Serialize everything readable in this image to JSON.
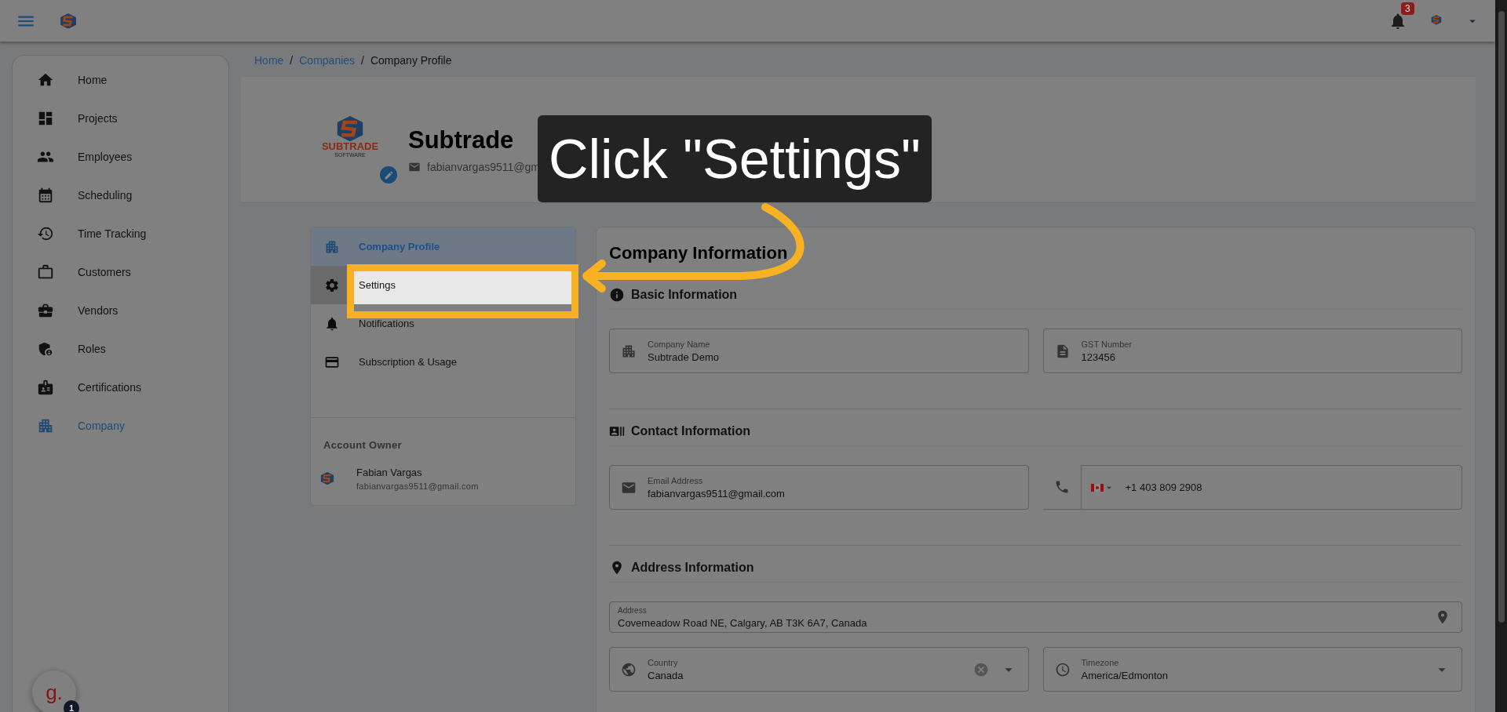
{
  "top_bar": {
    "notification_count": "3"
  },
  "sidebar": {
    "items": [
      {
        "label": "Home",
        "selected": false
      },
      {
        "label": "Projects",
        "selected": false
      },
      {
        "label": "Employees",
        "selected": false
      },
      {
        "label": "Scheduling",
        "selected": false
      },
      {
        "label": "Time Tracking",
        "selected": false
      },
      {
        "label": "Customers",
        "selected": false
      },
      {
        "label": "Vendors",
        "selected": false
      },
      {
        "label": "Roles",
        "selected": false
      },
      {
        "label": "Certifications",
        "selected": false
      },
      {
        "label": "Company",
        "selected": true
      }
    ]
  },
  "floating_button": {
    "label": "g.",
    "badge": "1"
  },
  "breadcrumb": [
    {
      "label": "Home",
      "kind": "link"
    },
    {
      "label": "/",
      "kind": "separator"
    },
    {
      "label": "Companies",
      "kind": "link"
    },
    {
      "label": "/",
      "kind": "separator"
    },
    {
      "label": "Company Profile",
      "kind": "current"
    }
  ],
  "profile": {
    "logo_text": "SUBTRADE",
    "logo_subtext": "SOFTWARE",
    "name": "Subtrade",
    "email": "fabianvargas9511@gm"
  },
  "settings_menu": {
    "items": [
      {
        "label": "Company Profile",
        "selected": true,
        "highlighted": false
      },
      {
        "label": "Settings",
        "selected": false,
        "highlighted": true
      },
      {
        "label": "Notifications",
        "selected": false,
        "highlighted": false
      },
      {
        "label": "Subscription & Usage",
        "selected": false,
        "highlighted": false
      }
    ],
    "account_owner": {
      "heading": "Account Owner",
      "name": "Fabian Vargas",
      "email": "fabianvargas9511@gmail.com"
    }
  },
  "company_information": {
    "title": "Company Information",
    "sections": [
      {
        "title": "Basic Information",
        "fields": [
          {
            "kind": "text",
            "label": "Company Name",
            "value": "Subtrade Demo"
          },
          {
            "kind": "text",
            "label": "GST Number",
            "value": "123456"
          }
        ]
      },
      {
        "title": "Contact Information",
        "fields": [
          {
            "kind": "text",
            "label": "Email Address",
            "value": "fabianvargas9511@gmail.com"
          },
          {
            "kind": "phone",
            "value": "+1 403 809 2908"
          }
        ]
      },
      {
        "title": "Address Information",
        "fields": [
          {
            "kind": "address",
            "label": "Address",
            "value": "Covemeadow Road NE, Calgary, AB T3K 6A7, Canada"
          },
          {
            "kind": "select",
            "label": "Country",
            "value": "Canada",
            "clearable": true
          },
          {
            "kind": "select",
            "label": "Timezone",
            "value": "America/Edmonton",
            "clearable": false
          }
        ]
      }
    ]
  },
  "tutorial": {
    "callout": "Click \"Settings\""
  }
}
